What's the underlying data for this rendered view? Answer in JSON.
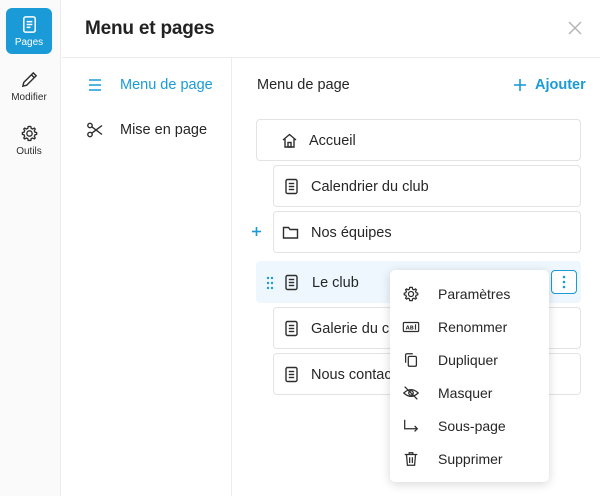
{
  "rail": {
    "items": [
      {
        "label": "Pages"
      },
      {
        "label": "Modifier"
      },
      {
        "label": "Outils"
      }
    ]
  },
  "header": {
    "title": "Menu et pages"
  },
  "nav": {
    "items": [
      {
        "label": "Menu de page"
      },
      {
        "label": "Mise en page"
      }
    ]
  },
  "main": {
    "title": "Menu de page",
    "add_label": "Ajouter",
    "pages": [
      {
        "label": "Accueil",
        "icon": "home-icon"
      },
      {
        "label": "Calendrier du club",
        "icon": "page-icon"
      },
      {
        "label": "Nos équipes",
        "icon": "folder-icon"
      },
      {
        "label": "Le club",
        "icon": "page-icon"
      },
      {
        "label": "Galerie du club",
        "icon": "page-icon"
      },
      {
        "label": "Nous contacter",
        "icon": "page-icon"
      }
    ]
  },
  "context_menu": {
    "items": [
      {
        "label": "Paramètres",
        "icon": "gear-icon"
      },
      {
        "label": "Renommer",
        "icon": "rename-icon"
      },
      {
        "label": "Dupliquer",
        "icon": "duplicate-icon"
      },
      {
        "label": "Masquer",
        "icon": "eye-off-icon"
      },
      {
        "label": "Sous-page",
        "icon": "subpage-arrow-icon"
      },
      {
        "label": "Supprimer",
        "icon": "trash-icon"
      }
    ]
  },
  "colors": {
    "accent": "#1a9bd7",
    "text": "#262626",
    "highlight": "#eef7fd"
  }
}
